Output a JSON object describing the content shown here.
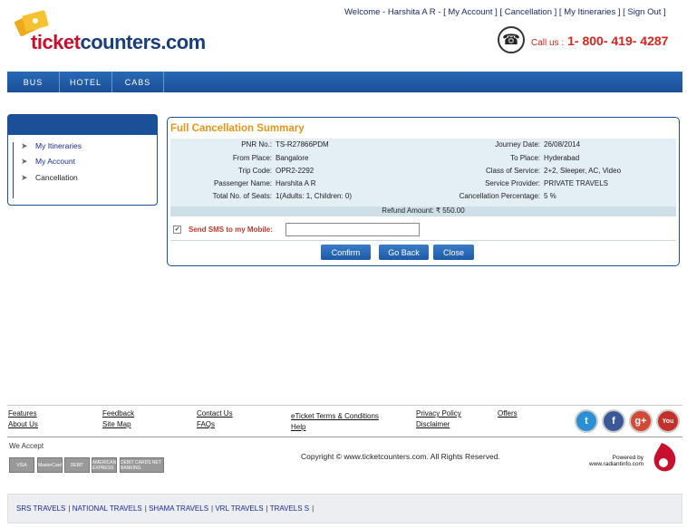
{
  "header": {
    "logo_text_a": "ticket",
    "logo_text_b": "counters.com",
    "welcome_prefix": "Welcome - Harshita A R -",
    "links": [
      "My Account",
      "Cancellation",
      "My Itineraries",
      "Sign Out"
    ],
    "callus_label": "Call us :",
    "phone": "1- 800- 419- 4287"
  },
  "nav": {
    "items": [
      "BUS",
      "HOTEL",
      "CABS"
    ]
  },
  "sidebar": {
    "items": [
      "My Itineraries",
      "My Account",
      "Cancellation"
    ]
  },
  "summary": {
    "title": "Full Cancellation Summary",
    "rows_left": [
      {
        "label": "PNR No.:",
        "value": "TS-R27866PDM"
      },
      {
        "label": "From Place:",
        "value": "Bangalore"
      },
      {
        "label": "Trip Code:",
        "value": "OPR2-2292"
      },
      {
        "label": "Passenger Name:",
        "value": "Harshita A R"
      },
      {
        "label": "Total No. of Seats:",
        "value": "1(Adults: 1, Children: 0)"
      }
    ],
    "rows_right": [
      {
        "label": "Journey Date:",
        "value": "26/08/2014"
      },
      {
        "label": "To Place:",
        "value": "Hyderabad"
      },
      {
        "label": "Class of Service:",
        "value": "2+2, Sleeper, AC, Video"
      },
      {
        "label": "Service Provider:",
        "value": "PRIVATE TRAVELS"
      },
      {
        "label": "Cancellation Percentage:",
        "value": "5 %"
      }
    ],
    "refund_label": "Refund Amount:",
    "refund_value": "₹ 550.00",
    "sms_label": "Send SMS to my Mobile:",
    "sms_value": "",
    "buttons": [
      "Confirm",
      "Go Back",
      "Close"
    ]
  },
  "footer": {
    "links": [
      [
        "Features",
        "About Us"
      ],
      [
        "Feedback",
        "Site Map"
      ],
      [
        "Contact Us",
        "FAQs"
      ],
      [
        "eTicket Terms & Conditions",
        "Help"
      ],
      [
        "Privacy Policy",
        "Disclaimer"
      ],
      [
        "Offers"
      ]
    ],
    "social": [
      "twitter-icon",
      "facebook-icon",
      "google-plus-icon",
      "youtube-icon"
    ],
    "we_accept": "We Accept",
    "cards": [
      "VISA",
      "MasterCard",
      "DEBIT",
      "AMERICAN EXPRESS",
      "DEBIT CARDS NET BANKING"
    ],
    "copyright": "Copyright © www.ticketcounters.com. All Rights Reserved.",
    "powered_by": "Powered by",
    "powered_url": "www.radiantinfo.com",
    "operators": [
      "SRS TRAVELS",
      "NATIONAL TRAVELS",
      "SHAMA TRAVELS",
      "VRL TRAVELS",
      "TRAVELS S"
    ]
  },
  "colors": {
    "brand_blue": "#1b4f97",
    "accent_orange": "#e8951a",
    "phone_red": "#d9261c"
  }
}
